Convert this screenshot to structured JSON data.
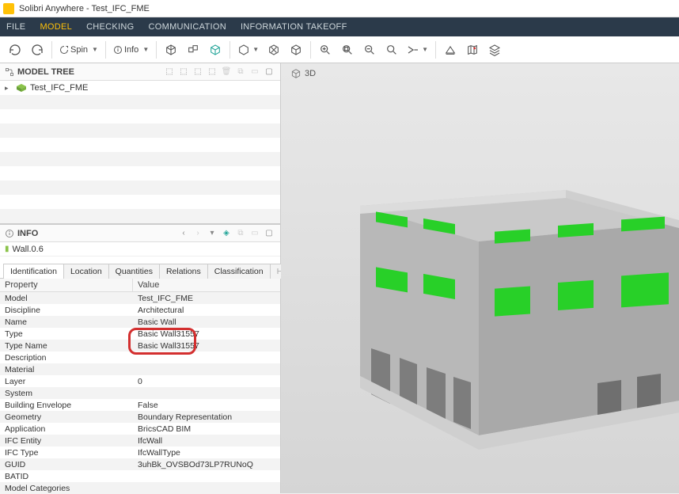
{
  "window": {
    "title": "Solibri Anywhere - Test_IFC_FME"
  },
  "menu": {
    "items": [
      {
        "label": "FILE",
        "active": false
      },
      {
        "label": "MODEL",
        "active": true
      },
      {
        "label": "CHECKING",
        "active": false
      },
      {
        "label": "COMMUNICATION",
        "active": false
      },
      {
        "label": "INFORMATION TAKEOFF",
        "active": false
      }
    ]
  },
  "toolbar": {
    "undo": "undo",
    "redo": "redo",
    "spin_label": "Spin",
    "info_label": "Info"
  },
  "modelTree": {
    "title": "MODEL TREE",
    "root": "Test_IFC_FME"
  },
  "info": {
    "title": "INFO",
    "selected": "Wall.0.6",
    "tabs": [
      {
        "label": "Identification",
        "active": true
      },
      {
        "label": "Location",
        "active": false
      },
      {
        "label": "Quantities",
        "active": false
      },
      {
        "label": "Relations",
        "active": false
      },
      {
        "label": "Classification",
        "active": false
      },
      {
        "label": "Hyperlinks",
        "active": false,
        "disabled": true
      }
    ],
    "header_property": "Property",
    "header_value": "Value",
    "properties": [
      {
        "name": "Model",
        "value": "Test_IFC_FME"
      },
      {
        "name": "Discipline",
        "value": "Architectural"
      },
      {
        "name": "Name",
        "value": "Basic Wall"
      },
      {
        "name": "Type",
        "value": "Basic Wall31557",
        "highlight": true
      },
      {
        "name": "Type Name",
        "value": "Basic Wall31557",
        "highlight": true
      },
      {
        "name": "Description",
        "value": ""
      },
      {
        "name": "Material",
        "value": ""
      },
      {
        "name": "Layer",
        "value": "0"
      },
      {
        "name": "System",
        "value": ""
      },
      {
        "name": "Building Envelope",
        "value": "False"
      },
      {
        "name": "Geometry",
        "value": "Boundary Representation"
      },
      {
        "name": "Application",
        "value": "BricsCAD BIM"
      },
      {
        "name": "IFC Entity",
        "value": "IfcWall"
      },
      {
        "name": "IFC Type",
        "value": "IfcWallType"
      },
      {
        "name": "GUID",
        "value": "3uhBk_OVSBOd73LP7RUNoQ"
      },
      {
        "name": "BATID",
        "value": ""
      },
      {
        "name": "Model Categories",
        "value": ""
      }
    ]
  },
  "viewport": {
    "title": "3D"
  }
}
